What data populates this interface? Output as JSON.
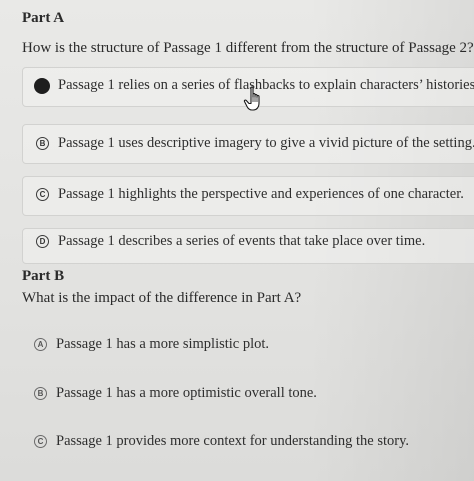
{
  "part_a": {
    "title": "Part A",
    "question": "How is the structure of Passage 1 different from the structure of Passage 2?",
    "selected": "A",
    "options": [
      {
        "letter": "A",
        "text": "Passage 1 relies on a series of flashbacks to explain characters’ histories."
      },
      {
        "letter": "B",
        "text": "Passage 1 uses descriptive imagery to give a vivid picture of the setting."
      },
      {
        "letter": "C",
        "text": "Passage 1 highlights the perspective and experiences of one character."
      },
      {
        "letter": "D",
        "text": "Passage 1 describes a series of events that take place over time."
      }
    ]
  },
  "part_b": {
    "title": "Part B",
    "question": "What is the impact of the difference in Part A?",
    "options": [
      {
        "letter": "A",
        "text": "Passage 1 has a more simplistic plot."
      },
      {
        "letter": "B",
        "text": "Passage 1 has a more optimistic overall tone."
      },
      {
        "letter": "C",
        "text": "Passage 1 provides more context for understanding the story."
      }
    ]
  },
  "colors": {
    "selected_indicator": "#1e1e1e",
    "text": "#2b2b2b",
    "background": "#e6e6e4"
  },
  "icons": {
    "cursor": "hand-pointer-icon"
  }
}
